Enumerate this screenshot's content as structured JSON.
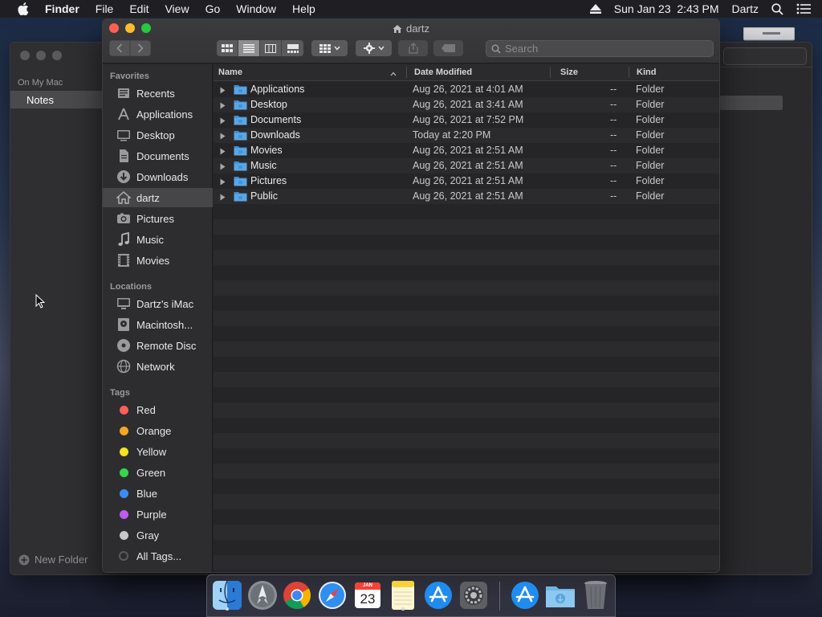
{
  "menubar": {
    "app_name": "Finder",
    "menus": [
      "File",
      "Edit",
      "View",
      "Go",
      "Window",
      "Help"
    ],
    "datetime": "Sun Jan 23  2:43 PM",
    "user": "Dartz"
  },
  "notes_window": {
    "section": "On My Mac",
    "folder": "Notes",
    "new_folder": "New Folder"
  },
  "finder": {
    "title": "dartz",
    "search_placeholder": "Search",
    "sidebar": {
      "favorites_title": "Favorites",
      "favorites": [
        {
          "label": "Recents",
          "icon": "recents-icon"
        },
        {
          "label": "Applications",
          "icon": "applications-icon"
        },
        {
          "label": "Desktop",
          "icon": "desktop-icon"
        },
        {
          "label": "Documents",
          "icon": "documents-icon"
        },
        {
          "label": "Downloads",
          "icon": "downloads-icon"
        },
        {
          "label": "dartz",
          "icon": "home-icon",
          "selected": true
        },
        {
          "label": "Pictures",
          "icon": "pictures-icon"
        },
        {
          "label": "Music",
          "icon": "music-icon"
        },
        {
          "label": "Movies",
          "icon": "movies-icon"
        }
      ],
      "locations_title": "Locations",
      "locations": [
        {
          "label": "Dartz's iMac",
          "icon": "imac-icon"
        },
        {
          "label": "Macintosh...",
          "icon": "hard-drive-icon"
        },
        {
          "label": "Remote Disc",
          "icon": "disc-icon"
        },
        {
          "label": "Network",
          "icon": "network-icon"
        }
      ],
      "tags_title": "Tags",
      "tags": [
        {
          "label": "Red",
          "color": "#fe5f57"
        },
        {
          "label": "Orange",
          "color": "#f5a623"
        },
        {
          "label": "Yellow",
          "color": "#f8e11f"
        },
        {
          "label": "Green",
          "color": "#32d74b"
        },
        {
          "label": "Blue",
          "color": "#3b8cf5"
        },
        {
          "label": "Purple",
          "color": "#bf5af2"
        },
        {
          "label": "Gray",
          "color": "#c8c8c8"
        },
        {
          "label": "All Tags...",
          "color": "#4a4a4c"
        }
      ]
    },
    "columns": {
      "name": "Name",
      "date": "Date Modified",
      "size": "Size",
      "kind": "Kind"
    },
    "rows": [
      {
        "name": "Applications",
        "date": "Aug 26, 2021 at 4:01 AM",
        "size": "--",
        "kind": "Folder"
      },
      {
        "name": "Desktop",
        "date": "Aug 26, 2021 at 3:41 AM",
        "size": "--",
        "kind": "Folder"
      },
      {
        "name": "Documents",
        "date": "Aug 26, 2021 at 7:52 PM",
        "size": "--",
        "kind": "Folder"
      },
      {
        "name": "Downloads",
        "date": "Today at 2:20 PM",
        "size": "--",
        "kind": "Folder"
      },
      {
        "name": "Movies",
        "date": "Aug 26, 2021 at 2:51 AM",
        "size": "--",
        "kind": "Folder"
      },
      {
        "name": "Music",
        "date": "Aug 26, 2021 at 2:51 AM",
        "size": "--",
        "kind": "Folder"
      },
      {
        "name": "Pictures",
        "date": "Aug 26, 2021 at 2:51 AM",
        "size": "--",
        "kind": "Folder"
      },
      {
        "name": "Public",
        "date": "Aug 26, 2021 at 2:51 AM",
        "size": "--",
        "kind": "Folder"
      }
    ]
  },
  "dock": {
    "apps": [
      "finder-icon",
      "launchpad-icon",
      "chrome-icon",
      "safari-icon",
      "calendar-icon",
      "notes-icon",
      "app-store-icon",
      "system-preferences-icon",
      "app-store-download-icon",
      "downloads-folder-icon",
      "trash-icon"
    ],
    "calendar_month": "JAN",
    "calendar_day": "23"
  }
}
